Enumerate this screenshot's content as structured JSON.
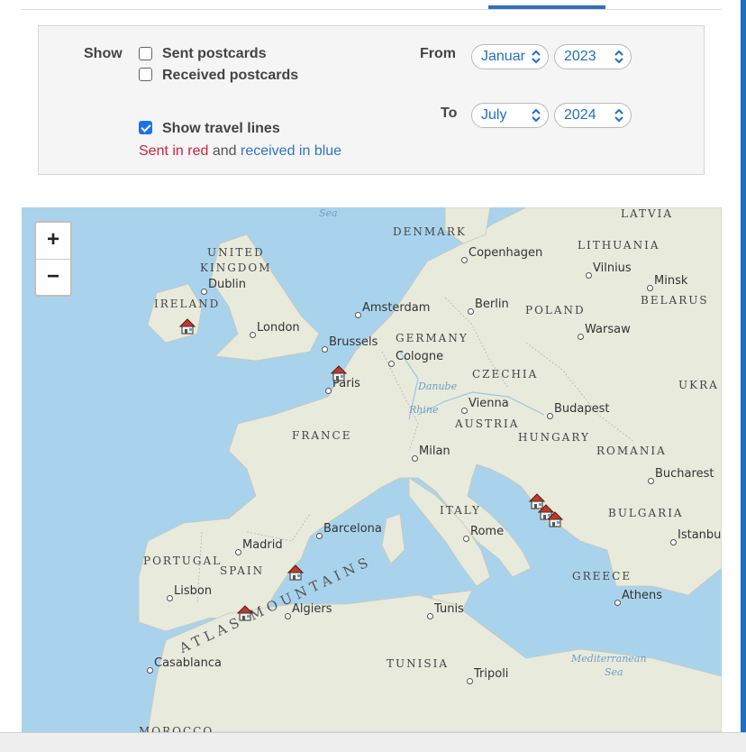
{
  "filters": {
    "show_label": "Show",
    "sent_label": "Sent postcards",
    "sent_checked": false,
    "received_label": "Received postcards",
    "received_checked": false,
    "travel_label": "Show travel lines",
    "travel_checked": true,
    "legend_sent": "Sent in red",
    "legend_and": "and",
    "legend_received": "received in blue",
    "from_label": "From",
    "from_month": "Januar",
    "from_year": "2023",
    "to_label": "To",
    "to_month": "July",
    "to_year": "2024"
  },
  "zoom": {
    "in": "+",
    "out": "−"
  },
  "map": {
    "cities": [
      {
        "name": "Copenhagen"
      },
      {
        "name": "Vilnius"
      },
      {
        "name": "Minsk"
      },
      {
        "name": "Dublin"
      },
      {
        "name": "Amsterdam"
      },
      {
        "name": "Berlin"
      },
      {
        "name": "London"
      },
      {
        "name": "Warsaw"
      },
      {
        "name": "Brussels"
      },
      {
        "name": "Cologne"
      },
      {
        "name": "Paris"
      },
      {
        "name": "Vienna"
      },
      {
        "name": "Budapest"
      },
      {
        "name": "Milan"
      },
      {
        "name": "Bucharest"
      },
      {
        "name": "Rome"
      },
      {
        "name": "Barcelona"
      },
      {
        "name": "Madrid"
      },
      {
        "name": "Istanbul"
      },
      {
        "name": "Lisbon"
      },
      {
        "name": "Athens"
      },
      {
        "name": "Algiers"
      },
      {
        "name": "Tunis"
      },
      {
        "name": "Casablanca"
      },
      {
        "name": "Tripoli"
      }
    ],
    "countries": [
      "DENMARK",
      "LITHUANIA",
      "UNITED",
      "KINGDOM",
      "IRELAND",
      "BELARUS",
      "POLAND",
      "GERMANY",
      "CZECHIA",
      "UKRA",
      "AUSTRIA",
      "HUNGARY",
      "FRANCE",
      "ROMANIA",
      "ITALY",
      "BULGARIA",
      "PORTUGAL",
      "SPAIN",
      "GREECE",
      "TUNISIA",
      "MOROCCO",
      "LATVIA"
    ],
    "features": [
      "Sea",
      "Danube",
      "Rhine",
      "ATLAS MOUNTAINS",
      "Mediterranean",
      "Sea"
    ],
    "markers": 8
  }
}
